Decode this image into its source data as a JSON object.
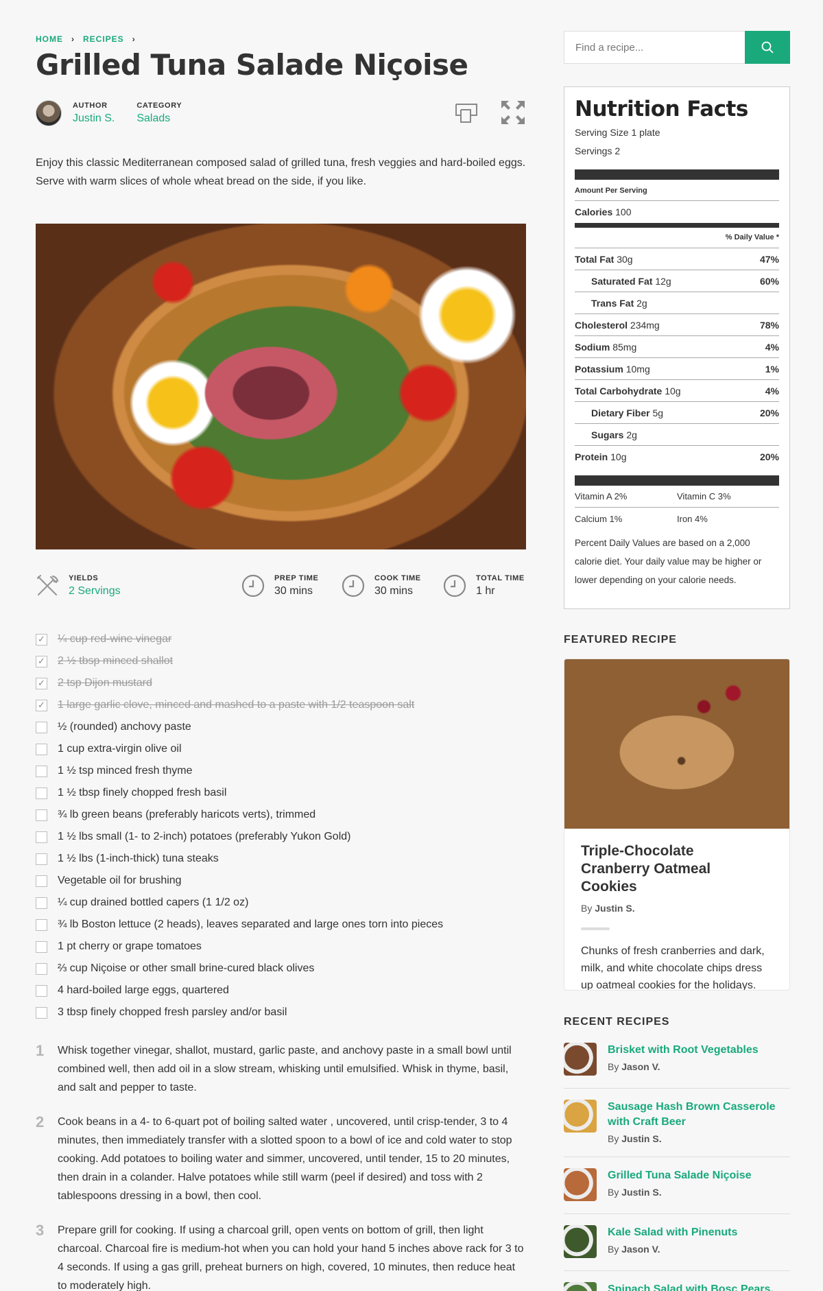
{
  "breadcrumb": {
    "home": "HOME",
    "recipes": "RECIPES",
    "sep": "›"
  },
  "recipe": {
    "title": "Grilled Tuna Salade Niçoise",
    "author_label": "AUTHOR",
    "author": "Justin S.",
    "category_label": "CATEGORY",
    "category": "Salads",
    "intro": "Enjoy this classic Mediterranean composed salad of grilled tuna, fresh veggies and hard-boiled eggs. Serve with warm slices of whole wheat bread on the side, if you like.",
    "yields_label": "YIELDS",
    "yields": "2 Servings",
    "prep_label": "PREP TIME",
    "prep": "30 mins",
    "cook_label": "COOK TIME",
    "cook": "30 mins",
    "total_label": "TOTAL TIME",
    "total": "1 hr"
  },
  "ingredients": [
    {
      "text": "¼ cup red-wine vinegar",
      "checked": true
    },
    {
      "text": "2 ½ tbsp minced shallot",
      "checked": true
    },
    {
      "text": "2 tsp Dijon mustard",
      "checked": true
    },
    {
      "text": "1 large garlic clove, minced and mashed to a paste with 1/2 teaspoon salt",
      "checked": true
    },
    {
      "text": "½ (rounded) anchovy paste",
      "checked": false
    },
    {
      "text": "1 cup extra-virgin olive oil",
      "checked": false
    },
    {
      "text": "1 ½ tsp minced fresh thyme",
      "checked": false
    },
    {
      "text": "1 ½ tbsp finely chopped fresh basil",
      "checked": false
    },
    {
      "text": "¾ lb green beans (preferably haricots verts), trimmed",
      "checked": false
    },
    {
      "text": "1 ½ lbs small (1- to 2-inch) potatoes (preferably Yukon Gold)",
      "checked": false
    },
    {
      "text": "1 ½ lbs (1-inch-thick) tuna steaks",
      "checked": false
    },
    {
      "text": "Vegetable oil for brushing",
      "checked": false
    },
    {
      "text": "¼ cup drained bottled capers (1 1/2 oz)",
      "checked": false
    },
    {
      "text": "¾ lb Boston lettuce (2 heads), leaves separated and large ones torn into pieces",
      "checked": false
    },
    {
      "text": "1 pt cherry or grape tomatoes",
      "checked": false
    },
    {
      "text": "⅔ cup Niçoise or other small brine-cured black olives",
      "checked": false
    },
    {
      "text": "4 hard-boiled large eggs, quartered",
      "checked": false
    },
    {
      "text": "3 tbsp finely chopped fresh parsley and/or basil",
      "checked": false
    }
  ],
  "steps": [
    {
      "num": "1",
      "text": "Whisk together vinegar, shallot, mustard, garlic paste, and anchovy paste in a small bowl until combined well, then add oil in a slow stream, whisking until emulsified. Whisk in thyme, basil, and salt and pepper to taste."
    },
    {
      "num": "2",
      "text": "Cook beans in a 4- to 6-quart pot of boiling salted water , uncovered, until crisp-tender, 3 to 4 minutes, then immediately transfer with a slotted spoon to a bowl of ice and cold water to stop cooking. Add potatoes to boiling water and simmer, uncovered, until tender, 15 to 20 minutes, then drain in a colander. Halve potatoes while still warm (peel if desired) and toss with 2 tablespoons dressing in a bowl, then cool."
    },
    {
      "num": "3",
      "text": "Prepare grill for cooking. If using a charcoal grill, open vents on bottom of grill, then light charcoal. Charcoal fire is medium-hot when you can hold your hand 5 inches above rack for 3 to 4 seconds. If using a gas grill, preheat burners on high, covered, 10 minutes, then reduce heat to moderately high."
    }
  ],
  "search": {
    "placeholder": "Find a recipe..."
  },
  "nutrition": {
    "title": "Nutrition Facts",
    "serving_size": "Serving Size 1 plate",
    "servings": "Servings 2",
    "amount_per_serving": "Amount Per Serving",
    "calories_label": "Calories",
    "calories": "100",
    "dv_header": "% Daily Value *",
    "rows": [
      {
        "label": "Total Fat",
        "amount": "30g",
        "dv": "47%",
        "indent": false
      },
      {
        "label": "Saturated Fat",
        "amount": "12g",
        "dv": "60%",
        "indent": true
      },
      {
        "label": "Trans Fat",
        "amount": "2g",
        "dv": "",
        "indent": true
      },
      {
        "label": "Cholesterol",
        "amount": "234mg",
        "dv": "78%",
        "indent": false
      },
      {
        "label": "Sodium",
        "amount": "85mg",
        "dv": "4%",
        "indent": false
      },
      {
        "label": "Potassium",
        "amount": "10mg",
        "dv": "1%",
        "indent": false
      },
      {
        "label": "Total Carbohydrate",
        "amount": "10g",
        "dv": "4%",
        "indent": false
      },
      {
        "label": "Dietary Fiber",
        "amount": "5g",
        "dv": "20%",
        "indent": true
      },
      {
        "label": "Sugars",
        "amount": "2g",
        "dv": "",
        "indent": true
      },
      {
        "label": "Protein",
        "amount": "10g",
        "dv": "20%",
        "indent": false
      }
    ],
    "vitamin_a": "Vitamin A 2%",
    "vitamin_c": "Vitamin C 3%",
    "calcium": "Calcium 1%",
    "iron": "Iron 4%",
    "footnote": "Percent Daily Values are based on a 2,000 calorie diet. Your daily value may be higher or lower depending on your calorie needs."
  },
  "featured": {
    "heading": "FEATURED RECIPE",
    "title": "Triple-Chocolate Cranberry Oatmeal Cookies",
    "by": "By",
    "author": "Justin S.",
    "description": "Chunks of fresh cranberries and dark, milk, and white chocolate chips dress up oatmeal cookies for the holidays."
  },
  "recent": {
    "heading": "RECENT RECIPES",
    "items": [
      {
        "title": "Brisket with Root Vegetables",
        "by": "By",
        "author": "Jason V.",
        "color": "#7a4a2e"
      },
      {
        "title": "Sausage Hash Brown Casserole with Craft Beer",
        "by": "By",
        "author": "Justin S.",
        "color": "#d9a441"
      },
      {
        "title": "Grilled Tuna Salade Niçoise",
        "by": "By",
        "author": "Justin S.",
        "color": "#b86a3a"
      },
      {
        "title": "Kale Salad with Pinenuts",
        "by": "By",
        "author": "Jason V.",
        "color": "#3e5a2c"
      },
      {
        "title": "Spinach Salad with Bosc Pears, Caramelized Red Onion & Toasted",
        "by": "",
        "author": "",
        "color": "#4e7a3a"
      }
    ]
  },
  "colors": {
    "accent": "#19a97b",
    "text": "#333333",
    "background": "#f7f7f8"
  }
}
